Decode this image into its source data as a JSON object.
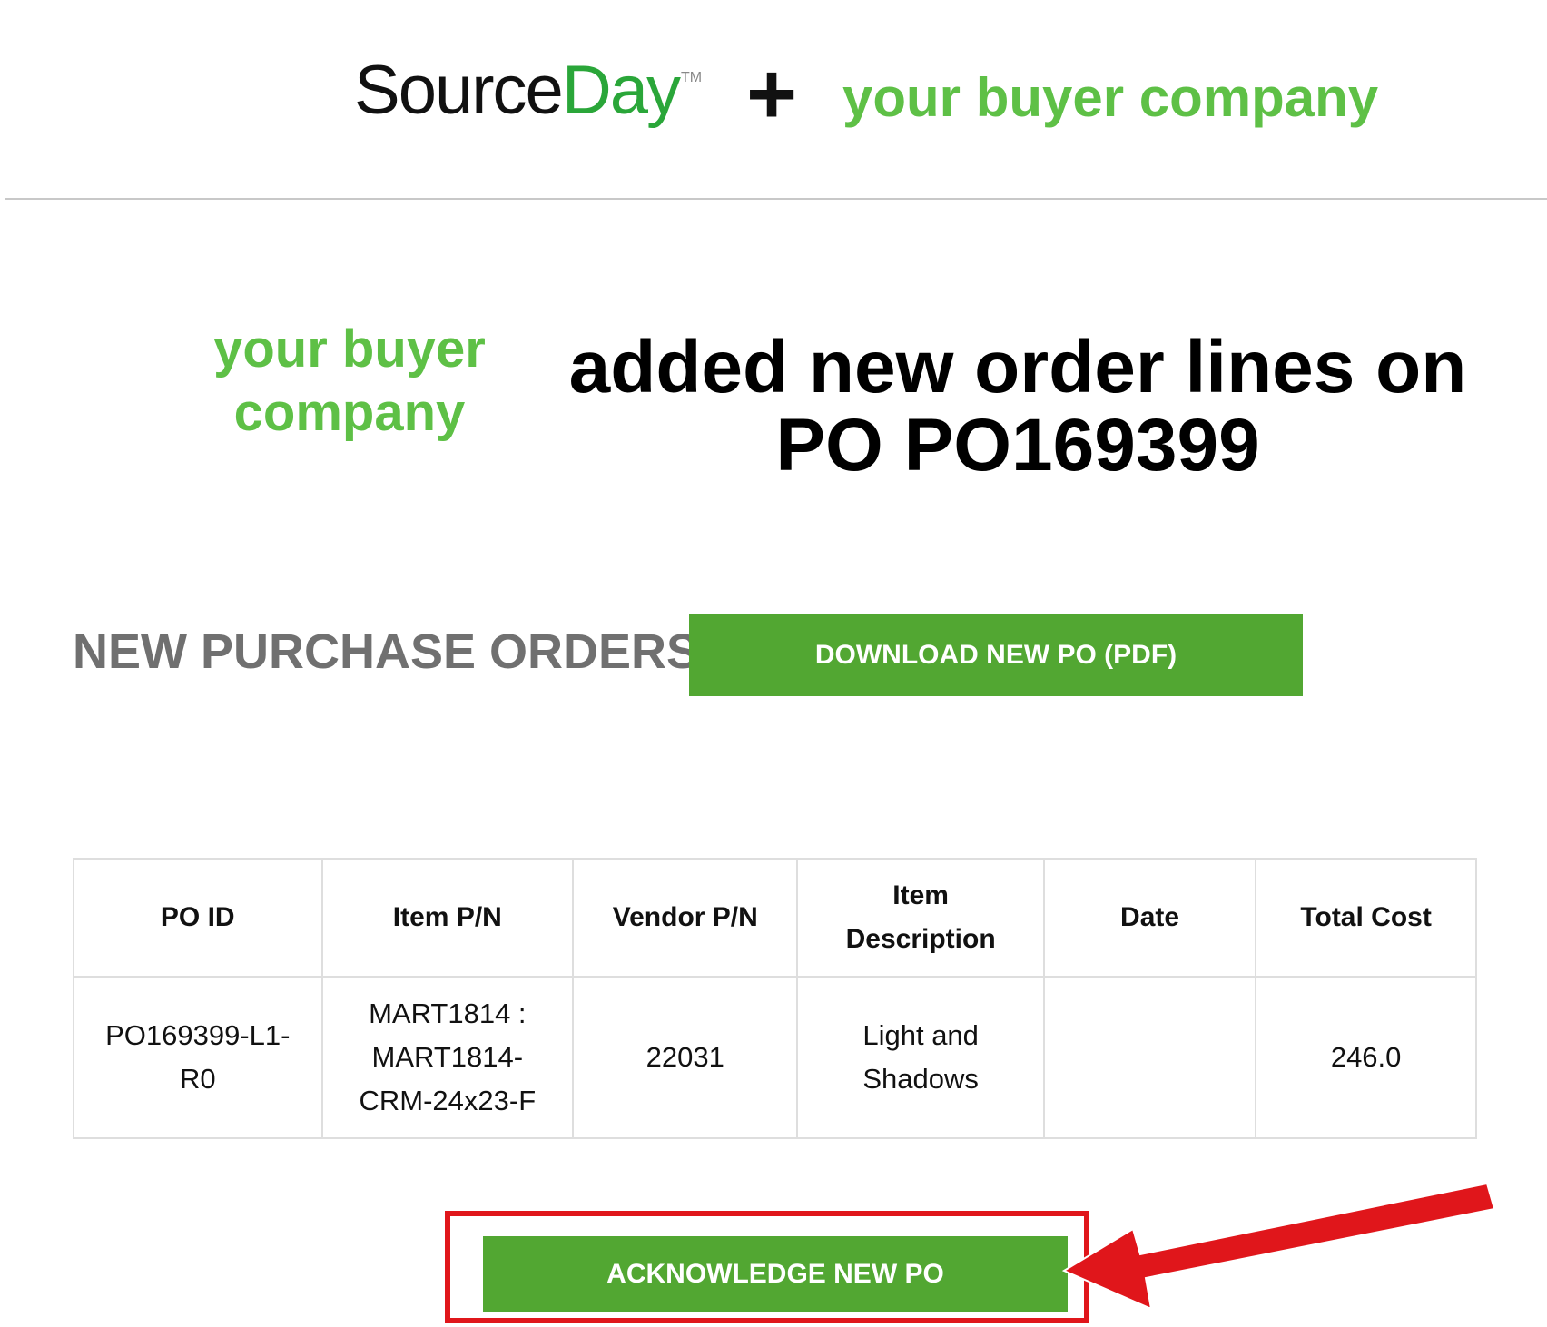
{
  "header": {
    "logo_source": "Source",
    "logo_day": "Day",
    "logo_tm": "TM",
    "plus": "+",
    "buyer_company": "your buyer company"
  },
  "headline": {
    "buyer_company": "your buyer company",
    "text": "added new order lines on PO PO169399"
  },
  "section": {
    "title": "NEW PURCHASE ORDERS",
    "download_button": "DOWNLOAD NEW PO (PDF)"
  },
  "table": {
    "headers": [
      "PO ID",
      "Item P/N",
      "Vendor P/N",
      "Item Description",
      "Date",
      "Total Cost"
    ],
    "rows": [
      [
        "PO169399-L1-R0",
        "MART1814 : MART1814-CRM-24x23-F",
        "22031",
        "Light and Shadows",
        "",
        "246.0"
      ]
    ]
  },
  "acknowledge_button": "ACKNOWLEDGE NEW PO",
  "colors": {
    "brand_green": "#52a732",
    "buyer_green": "#5ec046",
    "highlight_red": "#e0161b"
  },
  "icons": {
    "annotation_arrow": "red-arrow-icon"
  }
}
